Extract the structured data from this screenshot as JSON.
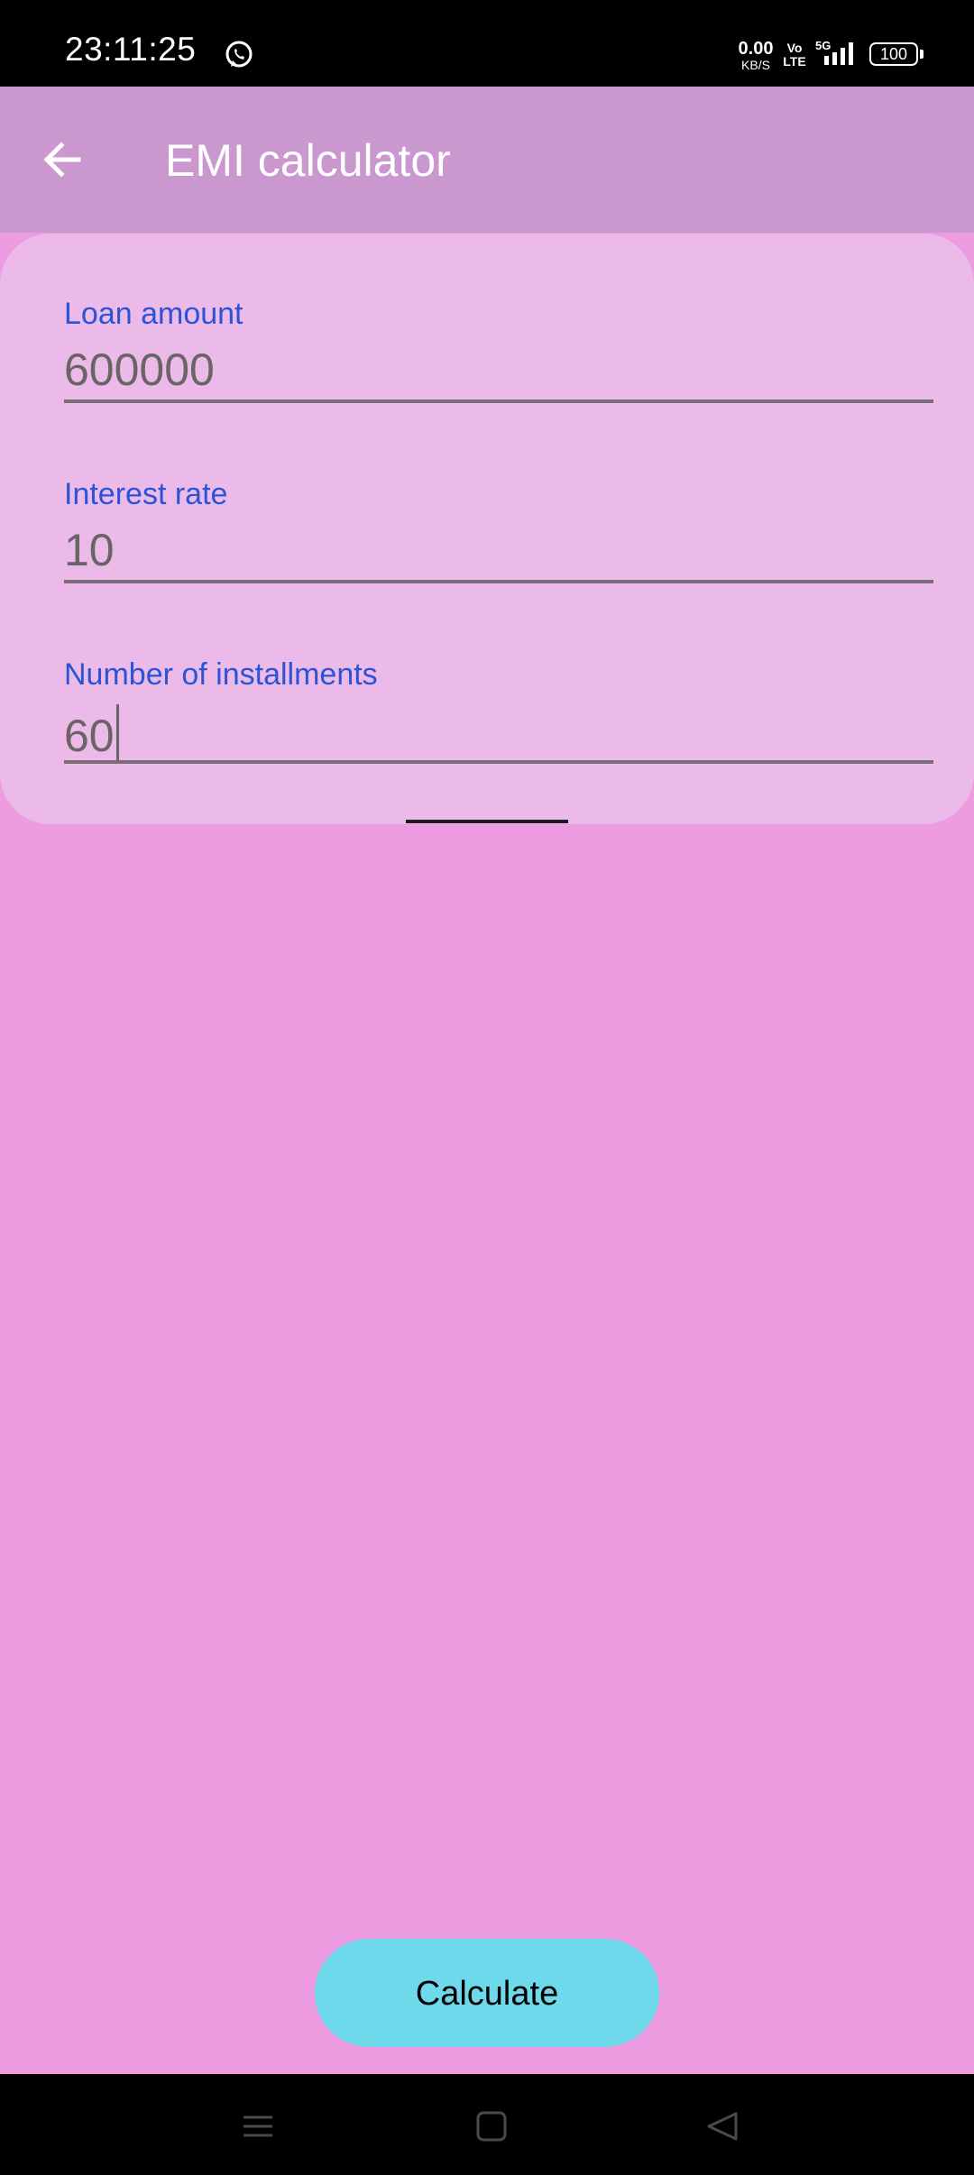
{
  "status_bar": {
    "time": "23:11:25",
    "net_speed_value": "0.00",
    "net_speed_unit": "KB/S",
    "volte_top": "Vo",
    "volte_bottom": "LTE",
    "network_type": "5G",
    "battery": "100"
  },
  "app_bar": {
    "title": "EMI calculator"
  },
  "form": {
    "loan_amount": {
      "label": "Loan amount",
      "value": "600000"
    },
    "interest_rate": {
      "label": "Interest rate",
      "value": "10"
    },
    "installments": {
      "label": "Number of installments",
      "value": "60"
    }
  },
  "actions": {
    "calculate_label": "Calculate"
  },
  "colors": {
    "background": "#ee9ce2",
    "app_bar": "#cb97cf",
    "card": "#ebbae9",
    "label_accent": "#2b53d6",
    "button": "#6fd9ec"
  },
  "icons": {
    "back": "arrow-left-icon",
    "whatsapp": "whatsapp-icon",
    "signal": "signal-icon",
    "nav_recents": "menu-lines-icon",
    "nav_home": "square-icon",
    "nav_back": "triangle-back-icon"
  }
}
